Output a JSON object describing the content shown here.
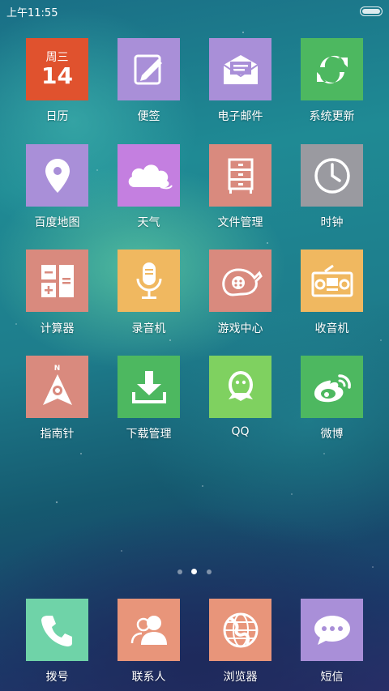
{
  "status_bar": {
    "time": "上午11:55",
    "battery_icon": "battery-icon"
  },
  "apps": [
    {
      "label": "日历",
      "color": "#e0522e",
      "icon": "calendar-icon",
      "calendar_day": "周三",
      "calendar_date": "14"
    },
    {
      "label": "便签",
      "color": "#a98fd8",
      "icon": "note-pencil-icon"
    },
    {
      "label": "电子邮件",
      "color": "#a98fd8",
      "icon": "mail-icon"
    },
    {
      "label": "系统更新",
      "color": "#4db860",
      "icon": "refresh-icon"
    },
    {
      "label": "百度地图",
      "color": "#a98fd8",
      "icon": "map-pin-icon"
    },
    {
      "label": "天气",
      "color": "#c47fe0",
      "icon": "cloud-icon"
    },
    {
      "label": "文件管理",
      "color": "#d98a7e",
      "icon": "file-cabinet-icon"
    },
    {
      "label": "时钟",
      "color": "#9a9aa0",
      "icon": "clock-icon"
    },
    {
      "label": "计算器",
      "color": "#d98a7e",
      "icon": "calculator-icon"
    },
    {
      "label": "录音机",
      "color": "#f0b860",
      "icon": "microphone-icon"
    },
    {
      "label": "游戏中心",
      "color": "#d98a7e",
      "icon": "gamepad-icon"
    },
    {
      "label": "收音机",
      "color": "#f0b860",
      "icon": "radio-icon"
    },
    {
      "label": "指南针",
      "color": "#d98a7e",
      "icon": "compass-icon",
      "compass_letter": "N"
    },
    {
      "label": "下载管理",
      "color": "#4db860",
      "icon": "download-icon"
    },
    {
      "label": "QQ",
      "color": "#7fd160",
      "icon": "qq-icon"
    },
    {
      "label": "微博",
      "color": "#4db860",
      "icon": "weibo-icon"
    }
  ],
  "page_indicator": {
    "count": 3,
    "active_index": 1
  },
  "dock": [
    {
      "label": "拨号",
      "color": "#6fd3a8",
      "icon": "phone-icon"
    },
    {
      "label": "联系人",
      "color": "#e8957a",
      "icon": "contacts-icon"
    },
    {
      "label": "浏览器",
      "color": "#e8957a",
      "icon": "globe-icon"
    },
    {
      "label": "短信",
      "color": "#a98fd8",
      "icon": "message-icon"
    }
  ]
}
